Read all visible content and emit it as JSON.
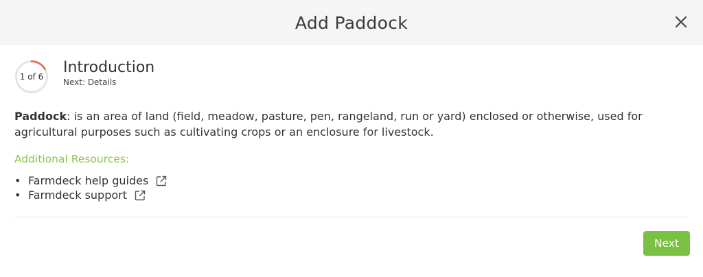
{
  "modal": {
    "title": "Add Paddock",
    "close_icon": "close-icon"
  },
  "progress": {
    "count_label": "1 of 6",
    "current_step": 1,
    "total_steps": 6,
    "step_title": "Introduction",
    "next_label": "Next: Details",
    "ring_color": "#e07a5f"
  },
  "definition": {
    "term": "Paddock",
    "text": ": is an area of land (field, meadow, pasture, pen, rangeland, run or yard) enclosed or otherwise, used for agricultural purposes such as cultivating crops or an enclosure for livestock."
  },
  "resources": {
    "title": "Additional Resources:",
    "items": [
      {
        "label": "Farmdeck help guides",
        "icon": "external-link-icon"
      },
      {
        "label": "Farmdeck support",
        "icon": "external-link-icon"
      }
    ]
  },
  "footer": {
    "next_button": "Next"
  },
  "colors": {
    "accent_green": "#7ac143",
    "resources_green": "#8cc63f",
    "header_bg": "#f5f5f5"
  }
}
